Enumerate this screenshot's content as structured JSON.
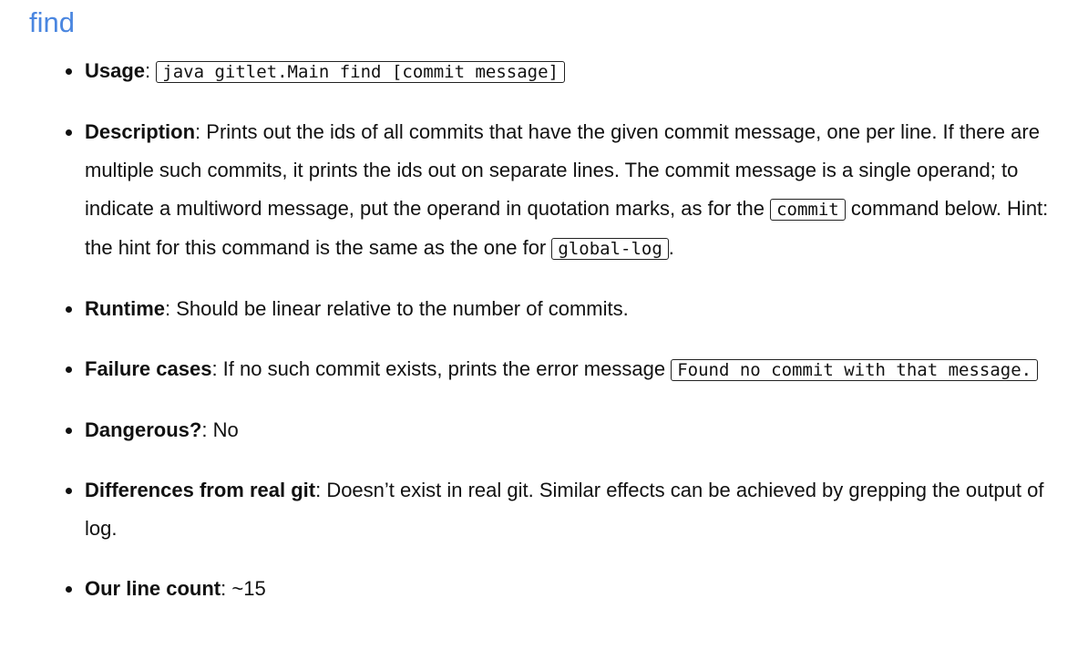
{
  "heading": "find",
  "items": [
    {
      "label": "Usage",
      "after_label": ": ",
      "code": "java gitlet.Main find [commit message]"
    },
    {
      "label": "Description",
      "after_label": ": ",
      "text1": "Prints out the ids of all commits that have the given commit message, one per line. If there are multiple such commits, it prints the ids out on separate lines. The commit message is a single operand; to indicate a multiword message, put the operand in quotation marks, as for the ",
      "code1": "commit",
      "text2": " command below. Hint: the hint for this command is the same as the one for ",
      "code2": "global-log",
      "text3": "."
    },
    {
      "label": "Runtime",
      "after_label": ": ",
      "text": "Should be linear relative to the number of commits."
    },
    {
      "label": "Failure cases",
      "after_label": ": ",
      "text": "If no such commit exists, prints the error message ",
      "code": "Found no commit with that message."
    },
    {
      "label": "Dangerous?",
      "after_label": ": ",
      "text": "No"
    },
    {
      "label": "Differences from real git",
      "after_label": ": ",
      "text": "Doesn’t exist in real git. Similar effects can be achieved by grepping the output of log."
    },
    {
      "label": "Our line count",
      "after_label": ": ",
      "text": "~15"
    }
  ]
}
